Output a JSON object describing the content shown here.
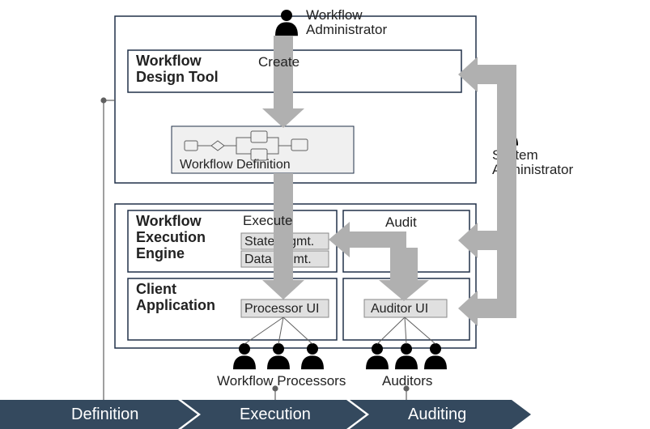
{
  "actors": {
    "workflow_admin": "Workflow\nAdministrator",
    "system_admin": "System\nAdministrator",
    "processors": "Workflow Processors",
    "auditors": "Auditors"
  },
  "boxes": {
    "design_tool": "Workflow\nDesign Tool",
    "workflow_def": "Workflow Definition",
    "exec_engine": "Workflow\nExecution\nEngine",
    "client_app": "Client\nApplication",
    "state_mgmt": "State mgmt.",
    "data_mgmt": "Data mgmt.",
    "processor_ui": "Processor UI",
    "auditor_ui": "Auditor UI"
  },
  "arrows": {
    "create": "Create",
    "execute": "Execute",
    "audit": "Audit"
  },
  "phases": {
    "definition": "Definition",
    "execution": "Execution",
    "auditing": "Auditing"
  },
  "colors": {
    "frame": "#203048",
    "arrow": "#b0b0b0",
    "shade": "#e8e8e8",
    "phase": "#2c3e50",
    "text": "#222"
  }
}
